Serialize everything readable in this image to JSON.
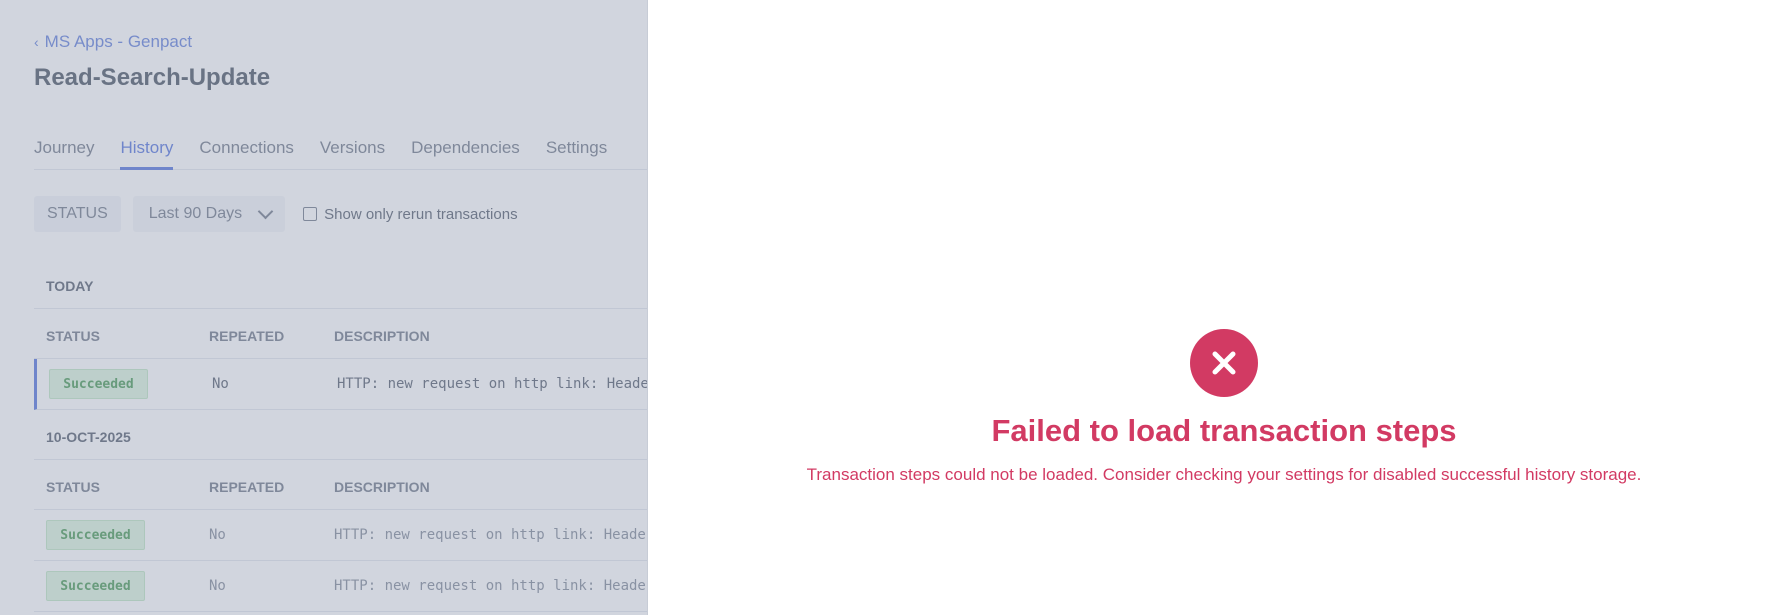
{
  "breadcrumb": {
    "back_label": "MS Apps - Genpact"
  },
  "page": {
    "title": "Read-Search-Update"
  },
  "tabs": [
    {
      "label": "Journey",
      "active": false
    },
    {
      "label": "History",
      "active": true
    },
    {
      "label": "Connections",
      "active": false
    },
    {
      "label": "Versions",
      "active": false
    },
    {
      "label": "Dependencies",
      "active": false
    },
    {
      "label": "Settings",
      "active": false
    }
  ],
  "filters": {
    "status_label": "STATUS",
    "range_selected": "Last 90 Days",
    "rerun_label": "Show only rerun transactions",
    "rerun_checked": false
  },
  "table": {
    "columns": [
      "STATUS",
      "REPEATED",
      "DESCRIPTION"
    ],
    "groups": [
      {
        "label": "TODAY",
        "rows": [
          {
            "status": "Succeeded",
            "repeated": "No",
            "description": "HTTP: new request on http link: Headers"
          }
        ]
      },
      {
        "label": "10-OCT-2025",
        "rows": [
          {
            "status": "Succeeded",
            "repeated": "No",
            "description": "HTTP: new request on http link: Headers"
          },
          {
            "status": "Succeeded",
            "repeated": "No",
            "description": "HTTP: new request on http link: Headers"
          }
        ]
      }
    ]
  },
  "error": {
    "icon": "close-icon",
    "title": "Failed to load transaction steps",
    "message": "Transaction steps could not be loaded. Consider checking your settings for disabled successful history storage."
  },
  "colors": {
    "accent": "#3a5fd8",
    "error": "#d23a63",
    "success_bg": "#d7f2d9",
    "success_text": "#2d8a3a",
    "overlay": "#a3acbd"
  }
}
